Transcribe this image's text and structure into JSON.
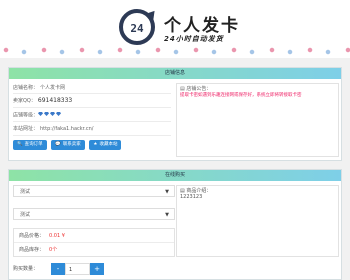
{
  "header": {
    "logo_number": "24",
    "title": "个人发卡",
    "subtitle": "24小时自动发货"
  },
  "shop_panel": {
    "title": "店铺信息",
    "shop_name_label": "店铺名称：",
    "shop_name": "个人发卡网",
    "qq_label": "卖家QQ：",
    "qq": "691418333",
    "level_label": "店铺等级：",
    "level_count": 4,
    "url_label": "本站网址：",
    "url": "http://faka1.hackr.cn/",
    "buttons": {
      "query_order": "查询订单",
      "contact_seller": "联系卖家",
      "favorite": "收藏本站"
    },
    "notice_label": "店铺公告：",
    "notice_text": "提取卡密如遇到乐趣连接网或保存好，系统立即将转接取卡密"
  },
  "buy_panel": {
    "title": "在线购买",
    "category_select": "测试",
    "product_select": "测试",
    "price_label": "商品价格：",
    "price": "0.01 ¥",
    "stock_label": "商品库存：",
    "stock": "0个",
    "desc_label": "商品介绍：",
    "desc_text": "1223123",
    "qty_label": "购买数量：",
    "qty_minus": "-",
    "qty_value": "1",
    "qty_plus": "+"
  },
  "colors": {
    "accent_blue": "#2e8bd8",
    "header_gradient_start": "#8ee3a6",
    "header_gradient_end": "#7ecfe8",
    "price_red": "#e33"
  }
}
